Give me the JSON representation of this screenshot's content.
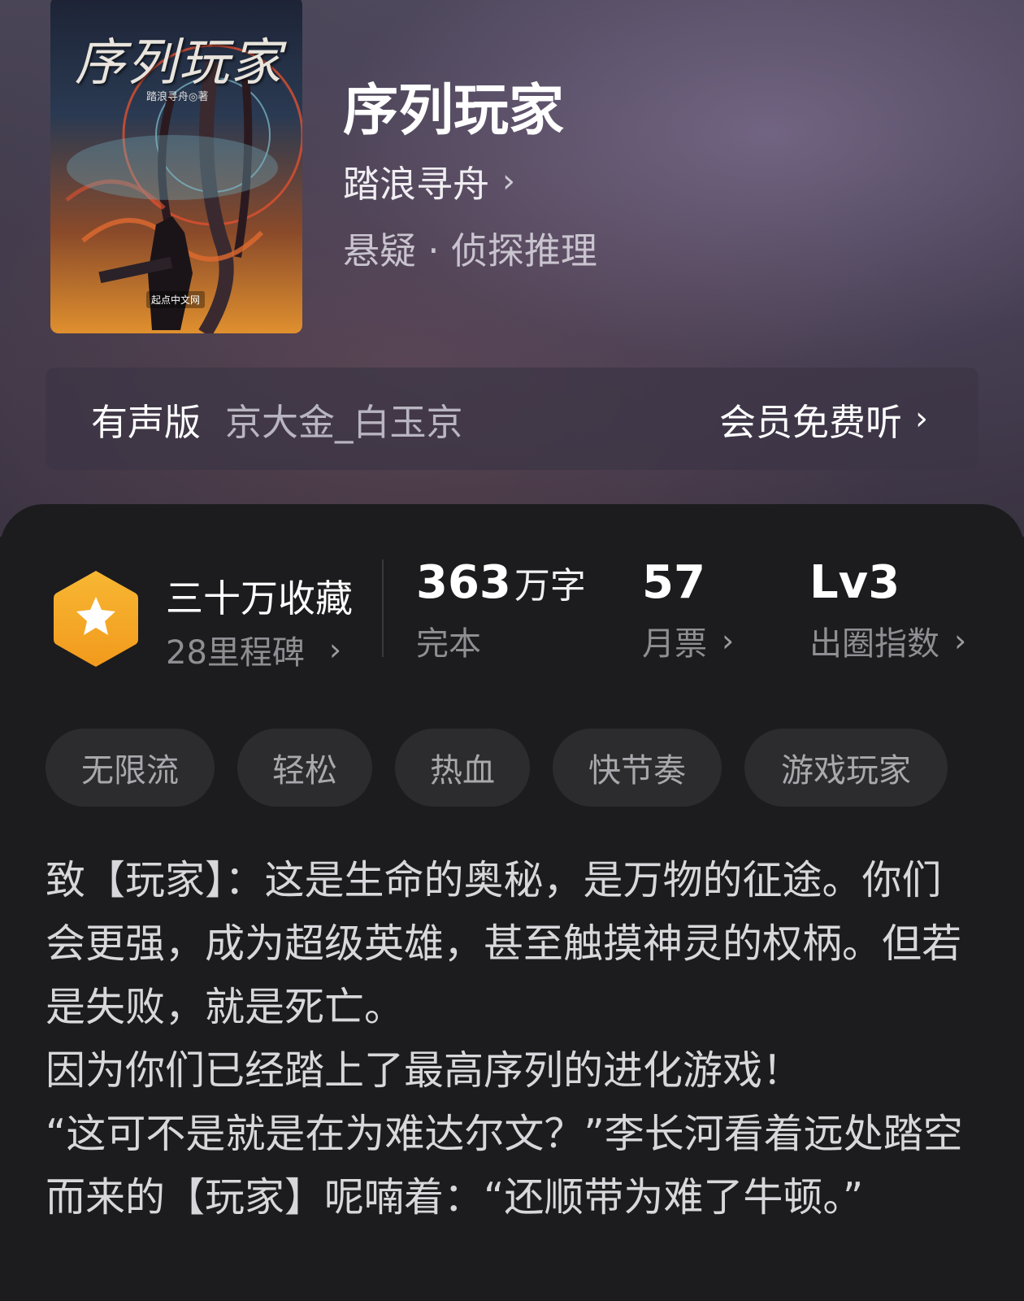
{
  "book": {
    "cover_title": "序列玩家",
    "cover_author": "踏浪寻舟◎著",
    "cover_publisher": "起点中文网",
    "title": "序列玩家",
    "author": "踏浪寻舟",
    "genre": "悬疑 · 侦探推理"
  },
  "audio": {
    "label": "有声版",
    "narrator": "京大金_白玉京",
    "action": "会员免费听"
  },
  "stats": {
    "favorites": "三十万收藏",
    "milestones": "28里程碑",
    "words_value": "363",
    "words_unit": "万字",
    "status": "完本",
    "monthly_tickets": "57",
    "monthly_label": "月票",
    "circle_level": "Lv3",
    "circle_label": "出圈指数"
  },
  "tags": [
    "无限流",
    "轻松",
    "热血",
    "快节奏",
    "游戏玩家"
  ],
  "synopsis": "致【玩家】：这是生命的奥秘，是万物的征途。你们会更强，成为超级英雄，甚至触摸神灵的权柄。但若是失败，就是死亡。\n因为你们已经踏上了最高序列的进化游戏！\n“这可不是就是在为难达尔文？”李长河看着远处踏空而来的【玩家】呢喃着：“还顺带为难了牛顿。”",
  "icons": {
    "chevron": "›",
    "badge": "star-badge-icon"
  },
  "colors": {
    "badge": "#f5a623",
    "panel": "#1c1c1e",
    "tag_bg": "#2c2c2e"
  }
}
